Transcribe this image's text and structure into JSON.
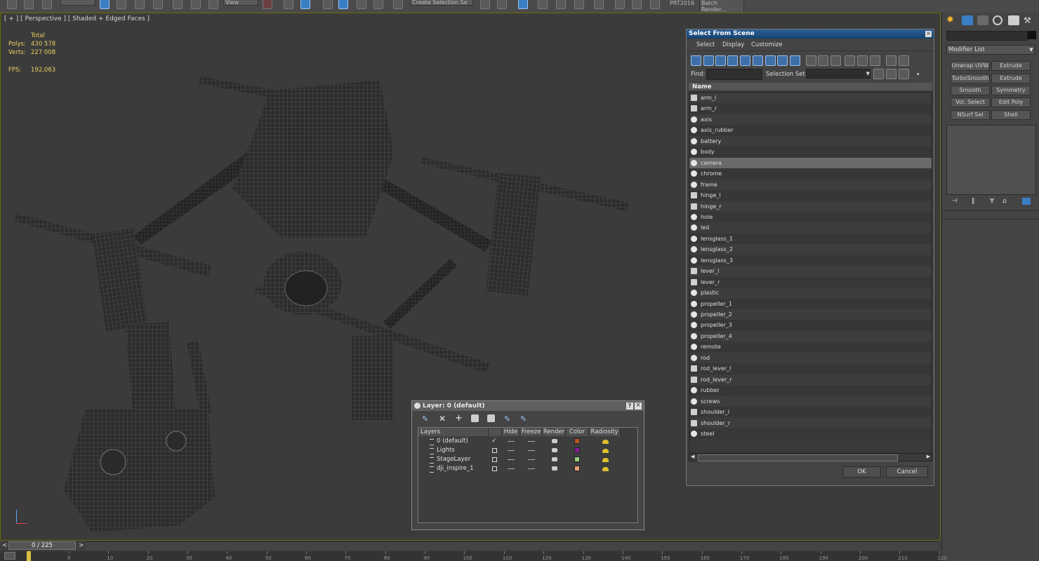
{
  "toolbar": {
    "view_dropdown": "View",
    "selection_set_dropdown": "Create Selection Se",
    "prt_label": "PRT2016",
    "batch_render_label": "Batch Render..."
  },
  "viewport": {
    "label": "[ + ] [ Perspective ] [ Shaded + Edged Faces ]",
    "stats": {
      "total_label": "Total",
      "polys_label": "Polys:",
      "polys_value": "430 578",
      "verts_label": "Verts:",
      "verts_value": "227 008",
      "fps_label": "FPS:",
      "fps_value": "192,063"
    }
  },
  "select_from_scene": {
    "title": "Select From Scene",
    "menu": [
      "Select",
      "Display",
      "Customize"
    ],
    "find_label": "Find:",
    "selection_set_label": "Selection Set:",
    "column_name": "Name",
    "selected_item": "camera",
    "items": [
      {
        "name": "arm_l",
        "icon": "group-icon"
      },
      {
        "name": "arm_r",
        "icon": "group-icon"
      },
      {
        "name": "axis",
        "icon": "mesh-icon"
      },
      {
        "name": "axis_rubber",
        "icon": "mesh-icon"
      },
      {
        "name": "battery",
        "icon": "mesh-icon"
      },
      {
        "name": "body",
        "icon": "mesh-icon"
      },
      {
        "name": "camera",
        "icon": "mesh-icon"
      },
      {
        "name": "chrome",
        "icon": "mesh-icon"
      },
      {
        "name": "frame",
        "icon": "mesh-icon"
      },
      {
        "name": "hinge_l",
        "icon": "group-icon"
      },
      {
        "name": "hinge_r",
        "icon": "group-icon"
      },
      {
        "name": "hole",
        "icon": "mesh-icon"
      },
      {
        "name": "led",
        "icon": "mesh-icon"
      },
      {
        "name": "lensglass_1",
        "icon": "mesh-icon"
      },
      {
        "name": "lensglass_2",
        "icon": "mesh-icon"
      },
      {
        "name": "lensglass_3",
        "icon": "mesh-icon"
      },
      {
        "name": "lever_l",
        "icon": "group-icon"
      },
      {
        "name": "lever_r",
        "icon": "group-icon"
      },
      {
        "name": "plastic",
        "icon": "mesh-icon"
      },
      {
        "name": "propeller_1",
        "icon": "mesh-icon"
      },
      {
        "name": "propeller_2",
        "icon": "mesh-icon"
      },
      {
        "name": "propeller_3",
        "icon": "mesh-icon"
      },
      {
        "name": "propeller_4",
        "icon": "mesh-icon"
      },
      {
        "name": "remote",
        "icon": "mesh-icon"
      },
      {
        "name": "rod",
        "icon": "mesh-icon"
      },
      {
        "name": "rod_lever_l",
        "icon": "group-icon"
      },
      {
        "name": "rod_lever_r",
        "icon": "group-icon"
      },
      {
        "name": "rubber",
        "icon": "mesh-icon"
      },
      {
        "name": "screws",
        "icon": "mesh-icon"
      },
      {
        "name": "shoulder_l",
        "icon": "group-icon"
      },
      {
        "name": "shoulder_r",
        "icon": "group-icon"
      },
      {
        "name": "steel",
        "icon": "mesh-icon"
      }
    ],
    "ok_label": "OK",
    "cancel_label": "Cancel"
  },
  "layer_dialog": {
    "title": "Layer: 0 (default)",
    "help_label": "?",
    "columns": [
      "Layers",
      "Hide",
      "Freeze",
      "Render",
      "Color",
      "Radiosity"
    ],
    "rows": [
      {
        "name": "0 (default)",
        "current": true,
        "color": "#c0541c"
      },
      {
        "name": "Lights",
        "current": false,
        "color": "#8a1a9a"
      },
      {
        "name": "StageLayer",
        "current": false,
        "color": "#9ad07a"
      },
      {
        "name": "dji_inspire_1",
        "current": false,
        "color": "#e8a07a"
      }
    ]
  },
  "command_panel": {
    "modifier_list": "Modifier List",
    "modifiers": [
      "Unwrap UVW",
      "Extrude",
      "TurboSmooth",
      "Extrude",
      "Smooth",
      "Symmetry",
      "Vol. Select",
      "Edit Poly",
      "NSurf Sel",
      "Shell"
    ]
  },
  "timeline": {
    "frame_counter": "0 / 225",
    "prev_label": "<",
    "next_label": ">",
    "ruler_ticks": [
      "0",
      "10",
      "20",
      "30",
      "40",
      "50",
      "60",
      "70",
      "80",
      "90",
      "100",
      "110",
      "120",
      "130",
      "140",
      "150",
      "160",
      "170",
      "180",
      "190",
      "200",
      "210",
      "220"
    ]
  },
  "colors": {
    "accent": "#3a7ec4",
    "viewport_bg": "#3b3b3b",
    "stats_text": "#e8d060",
    "title_bar": "#2b5f97"
  }
}
